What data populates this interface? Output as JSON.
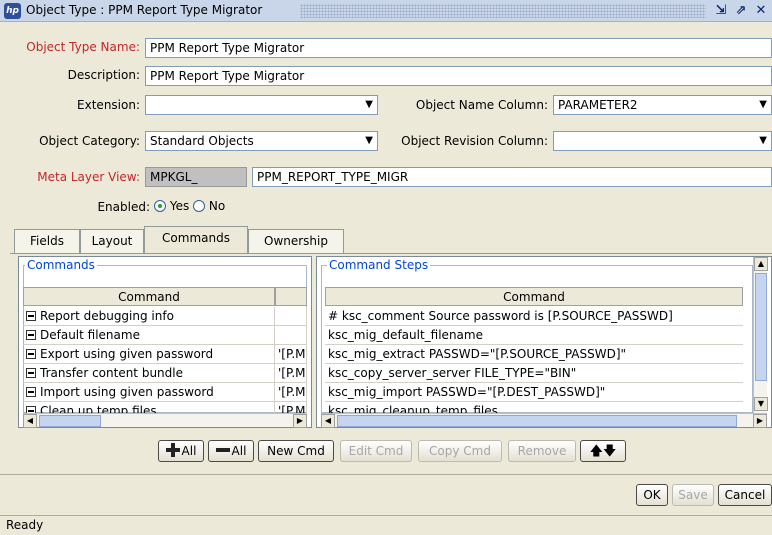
{
  "window": {
    "app_icon": "hp",
    "title": "Object Type : PPM Report Type Migrator",
    "buttons": [
      "restore-icon",
      "maximize-icon",
      "close-icon"
    ]
  },
  "form": {
    "object_type_name": {
      "label": "Object Type Name:",
      "value": "PPM Report Type Migrator"
    },
    "description": {
      "label": "Description:",
      "value": "PPM Report Type Migrator"
    },
    "extension": {
      "label": "Extension:",
      "value": ""
    },
    "object_name_column": {
      "label": "Object Name Column:",
      "value": "PARAMETER2"
    },
    "object_category": {
      "label": "Object Category:",
      "value": "Standard Objects"
    },
    "object_revision_column": {
      "label": "Object Revision Column:",
      "value": ""
    },
    "meta_layer_view": {
      "label": "Meta Layer View:",
      "prefix": "MPKGL_",
      "value": "PPM_REPORT_TYPE_MIGR"
    },
    "enabled": {
      "label": "Enabled:",
      "yes": "Yes",
      "no": "No",
      "selected": "Yes"
    }
  },
  "tabs": [
    {
      "label": "Fields"
    },
    {
      "label": "Layout"
    },
    {
      "label": "Commands",
      "active": true
    },
    {
      "label": "Ownership"
    }
  ],
  "commands_panel": {
    "title": "Commands",
    "column": "Command",
    "rows": [
      {
        "command": "Report debugging info",
        "cond": ""
      },
      {
        "command": "Default filename",
        "cond": ""
      },
      {
        "command": "Export using given password",
        "cond": "'[P.MI"
      },
      {
        "command": "Transfer content bundle",
        "cond": "'[P.MI"
      },
      {
        "command": "Import using given password",
        "cond": "'[P.MI"
      },
      {
        "command": "Clean up temp files",
        "cond": "'[P.MI"
      }
    ]
  },
  "steps_panel": {
    "title": "Command Steps",
    "column": "Command",
    "rows": [
      "# ksc_comment Source password is [P.SOURCE_PASSWD]",
      "ksc_mig_default_filename",
      "ksc_mig_extract PASSWD=\"[P.SOURCE_PASSWD]\"",
      "ksc_copy_server_server FILE_TYPE=\"BIN\"",
      "ksc_mig_import PASSWD=\"[P.DEST_PASSWD]\"",
      "ksc_mig_cleanup_temp_files"
    ]
  },
  "command_buttons": {
    "expand_all": "All",
    "collapse_all": "All",
    "new_cmd": "New Cmd",
    "edit_cmd": "Edit Cmd",
    "copy_cmd": "Copy Cmd",
    "remove": "Remove"
  },
  "dialog_buttons": {
    "ok": "OK",
    "save": "Save",
    "cancel": "Cancel"
  },
  "status": "Ready"
}
